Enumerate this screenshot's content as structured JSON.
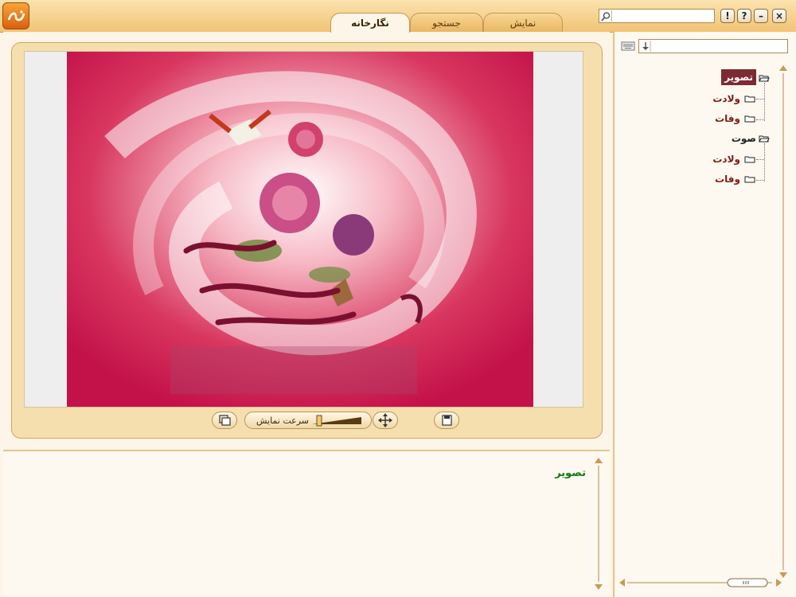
{
  "tabs": [
    {
      "label": "نمایش"
    },
    {
      "label": "جستجو"
    },
    {
      "label": "نگارخانه"
    }
  ],
  "search": {
    "value": "",
    "placeholder": ""
  },
  "window_buttons": {
    "info": "!",
    "help": "?",
    "minimize": "–",
    "close": "×"
  },
  "controls": {
    "speed_label": "سرعت نمایش",
    "speed_level": 0.15
  },
  "description": {
    "title": "تصویر"
  },
  "sidebar": {
    "filter_value": "",
    "tree": [
      {
        "label": "تصویر",
        "selected": true,
        "children": [
          {
            "label": "ولادت"
          },
          {
            "label": "وفات"
          }
        ]
      },
      {
        "label": "صوت",
        "selected": false,
        "children": [
          {
            "label": "ولادت"
          },
          {
            "label": "وفات"
          }
        ]
      }
    ]
  },
  "colors": {
    "accent": "#f2c374",
    "selected": "#7d2a32",
    "title_green": "#0f7a14",
    "child_text": "#7a1d14"
  }
}
